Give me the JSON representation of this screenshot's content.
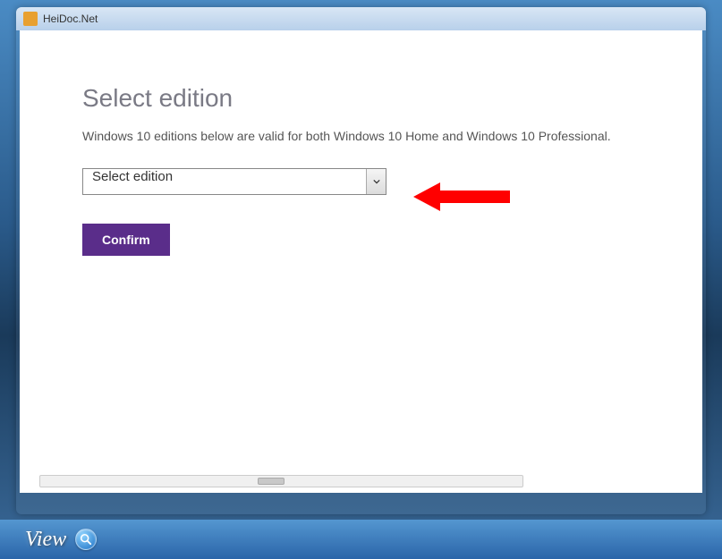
{
  "window": {
    "title": "HeiDoc.Net"
  },
  "page": {
    "heading": "Select edition",
    "description": "Windows 10 editions below are valid for both Windows 10 Home and Windows 10 Professional.",
    "select": {
      "placeholder": "Select edition"
    },
    "confirm_label": "Confirm"
  },
  "bottom": {
    "view_label": "View"
  },
  "annotation": {
    "arrow_color": "#ff0000"
  },
  "colors": {
    "button_bg": "#5a2d8a"
  }
}
